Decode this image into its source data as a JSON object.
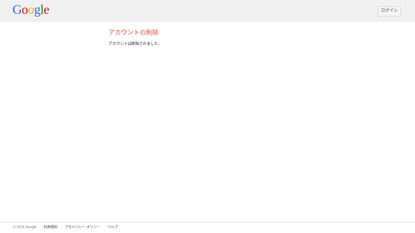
{
  "header": {
    "logo_letters": [
      {
        "char": "G",
        "color": "#3369e8"
      },
      {
        "char": "o",
        "color": "#d50f25"
      },
      {
        "char": "o",
        "color": "#eeb211"
      },
      {
        "char": "g",
        "color": "#3369e8"
      },
      {
        "char": "l",
        "color": "#009925"
      },
      {
        "char": "e",
        "color": "#d50f25"
      }
    ],
    "login_label": "ログイン"
  },
  "main": {
    "title": "アカウントの削除",
    "title_color": "#dd4b39",
    "message": "アカウントは削除されました。"
  },
  "footer": {
    "copyright": "© 2013 Google",
    "links": [
      "利用規約",
      "プライバシー ポリシー",
      "ヘルプ"
    ]
  }
}
